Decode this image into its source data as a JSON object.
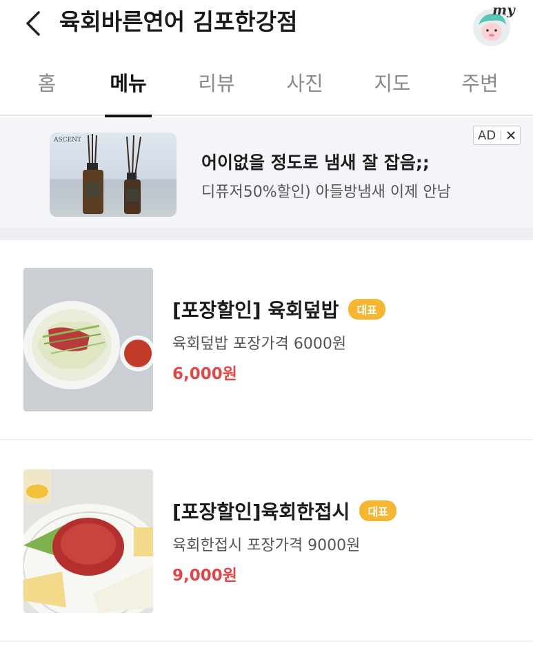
{
  "header": {
    "title": "육회바른연어 김포한강점",
    "back_icon": "chevron-left-icon",
    "avatar_label": "my"
  },
  "tabs": [
    {
      "label": "홈",
      "active": false
    },
    {
      "label": "메뉴",
      "active": true
    },
    {
      "label": "리뷰",
      "active": false
    },
    {
      "label": "사진",
      "active": false
    },
    {
      "label": "지도",
      "active": false
    },
    {
      "label": "주변",
      "active": false
    }
  ],
  "ad": {
    "image_brand": "ASCENT",
    "headline": "어이없을 정도로 냄새 잘 잡음;;",
    "subtext": "디퓨저50%할인) 아들방냄새 이제 안남",
    "badge_label": "AD",
    "close_icon": "close-icon"
  },
  "menu_items": [
    {
      "name": "[포장할인] 육회덮밥",
      "badge": "대표",
      "description": "육회덮밥 포장가격 6000원",
      "price": "6,000원"
    },
    {
      "name": "[포장할인]육회한접시",
      "badge": "대표",
      "description": "육회한접시 포장가격 9000원",
      "price": "9,000원"
    }
  ],
  "colors": {
    "price": "#e04848",
    "badge": "#f5b731",
    "ad_background": "#f3f5f8"
  }
}
